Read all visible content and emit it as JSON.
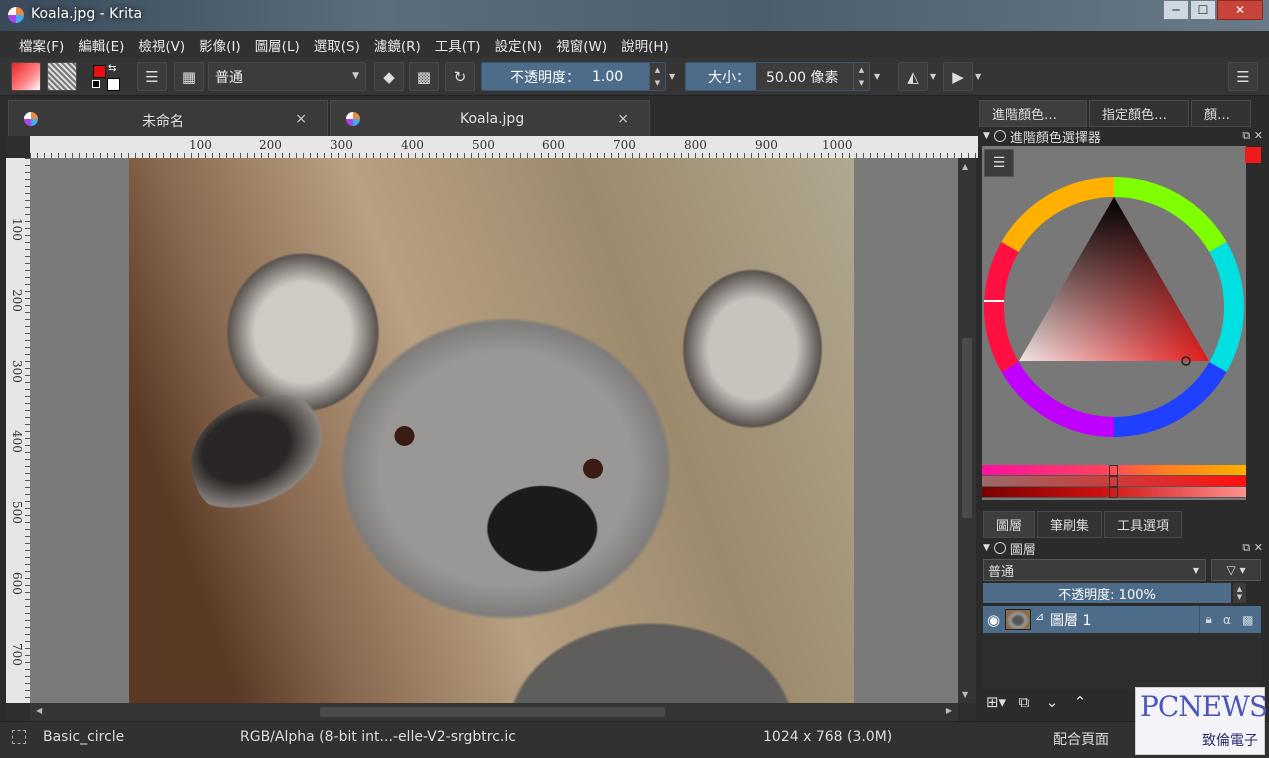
{
  "window": {
    "title": "Koala.jpg  - Krita",
    "min_glyph": "─",
    "max_glyph": "☐",
    "close_glyph": "✕"
  },
  "menu": [
    "檔案(F)",
    "編輯(E)",
    "檢視(V)",
    "影像(I)",
    "圖層(L)",
    "選取(S)",
    "濾鏡(R)",
    "工具(T)",
    "設定(N)",
    "視窗(W)",
    "說明(H)"
  ],
  "toolbar": {
    "blend_mode": "普通",
    "opacity_label": "不透明度：",
    "opacity_value": "1.00",
    "size_label": "大小：",
    "size_value": "50.00 像素"
  },
  "tabs": [
    {
      "label": "未命名"
    },
    {
      "label": "Koala.jpg"
    }
  ],
  "ruler": {
    "h_ticks": [
      "100",
      "200",
      "300",
      "400",
      "500",
      "600",
      "700",
      "800",
      "900",
      "1000"
    ],
    "v_ticks": [
      "100",
      "200",
      "300",
      "400",
      "500",
      "600",
      "700"
    ]
  },
  "dockers": {
    "top_tabs": [
      "進階顏色…",
      "指定顏色…",
      "顏…"
    ],
    "color_selector_title": "進階顏色選擇器",
    "bottom_tabs": [
      "圖層",
      "筆刷集",
      "工具選項"
    ],
    "layers_title": "圖層",
    "layer_blend_mode": "普通",
    "layer_opacity": "不透明度: 100%",
    "layers": [
      {
        "name": "圖層 1"
      }
    ],
    "foreground_color": "#ee1c1c"
  },
  "status": {
    "brush": "Basic_circle",
    "color_profile": "RGB/Alpha (8-bit int...-elle-V2-srgbtrc.ic",
    "dimensions": "1024 x 768 (3.0M)",
    "zoom_mode": "配合頁面"
  },
  "watermark": {
    "title": "PCNEWS",
    "subtitle": "致倫電子"
  }
}
